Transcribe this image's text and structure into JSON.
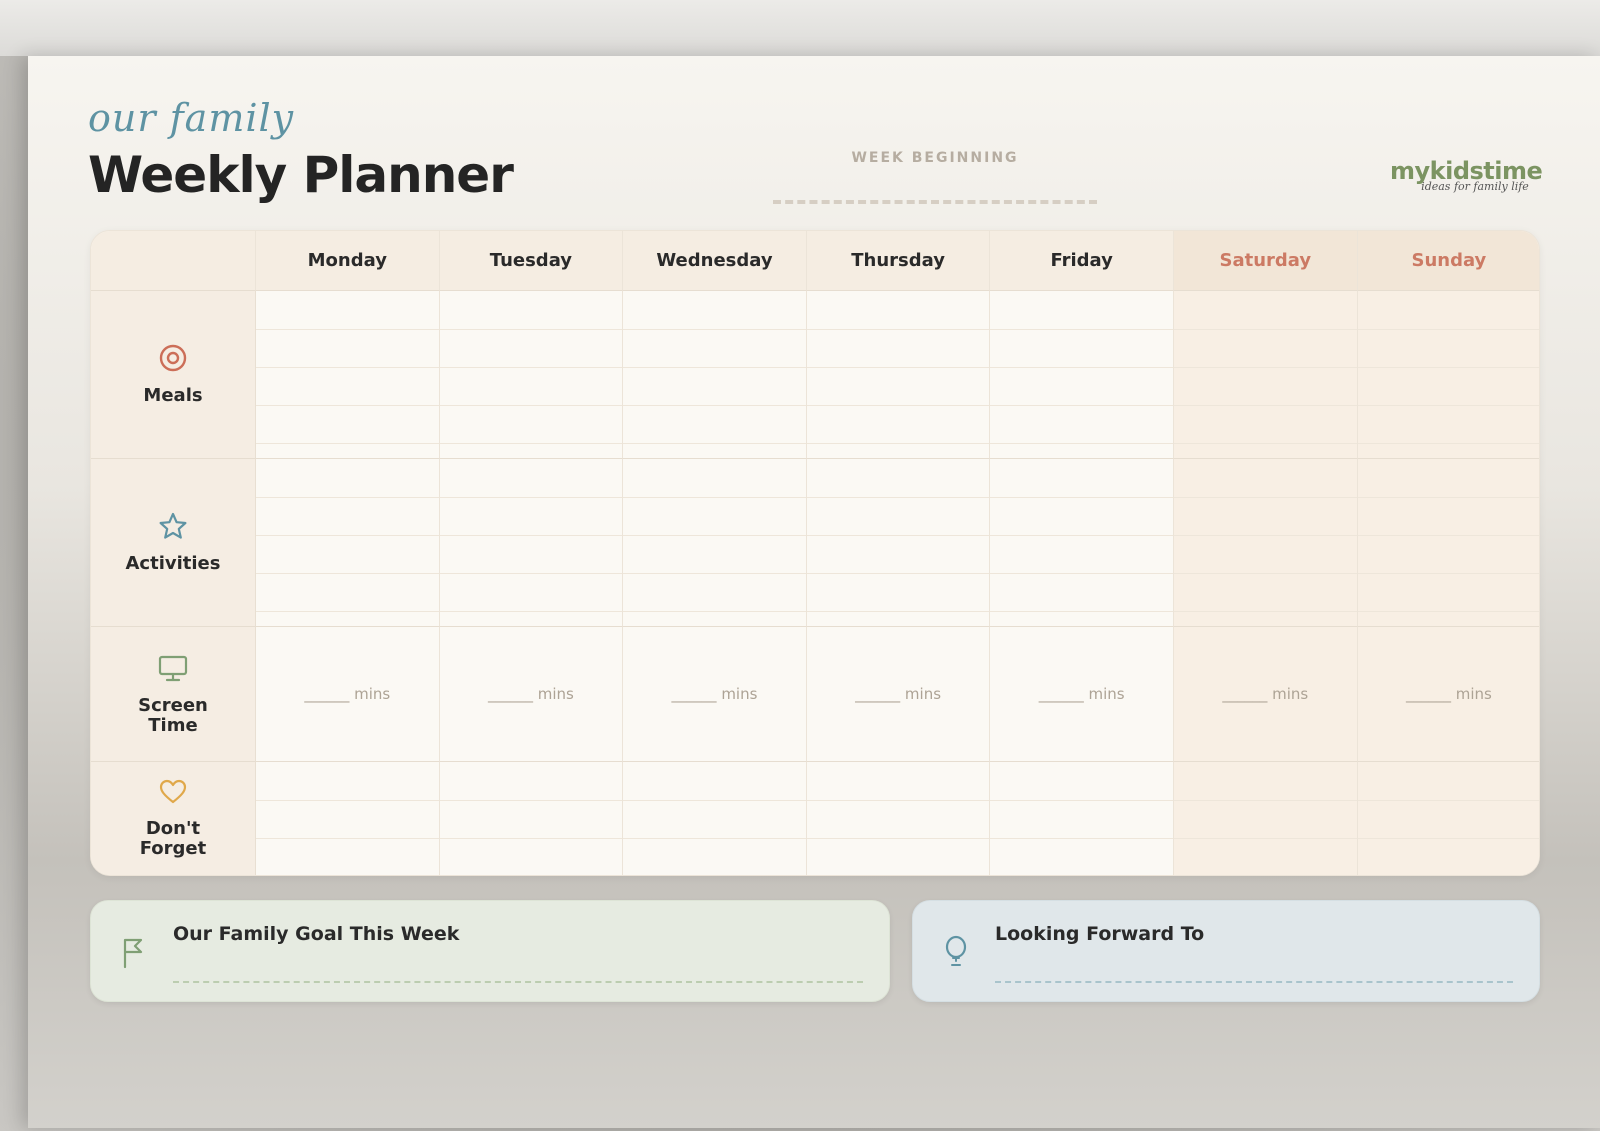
{
  "header": {
    "script_title": "our family",
    "title": "Weekly Planner",
    "week_label": "WEEK BEGINNING"
  },
  "brand": {
    "name": "mykidstime",
    "tagline": "ideas for family life"
  },
  "days": [
    {
      "label": "Monday",
      "weekend": false
    },
    {
      "label": "Tuesday",
      "weekend": false
    },
    {
      "label": "Wednesday",
      "weekend": false
    },
    {
      "label": "Thursday",
      "weekend": false
    },
    {
      "label": "Friday",
      "weekend": false
    },
    {
      "label": "Saturday",
      "weekend": true
    },
    {
      "label": "Sunday",
      "weekend": true
    }
  ],
  "rows": [
    {
      "label": "Meals",
      "icon": "target-icon",
      "icon_color": "#cc6e58",
      "lines": 4,
      "kind": "lines"
    },
    {
      "label": "Activities",
      "icon": "star-icon",
      "icon_color": "#5e93a3",
      "lines": 4,
      "kind": "lines"
    },
    {
      "label": "Screen\nTime",
      "icon": "monitor-icon",
      "icon_color": "#7f9f74",
      "lines": 0,
      "kind": "mins"
    },
    {
      "label": "Don't\nForget",
      "icon": "heart-icon",
      "icon_color": "#e0a84a",
      "lines": 3,
      "kind": "lines"
    }
  ],
  "screen_time_placeholder": "______ mins",
  "boxes": {
    "goal": {
      "title": "Our Family Goal This Week",
      "icon": "flag-icon"
    },
    "forward": {
      "title": "Looking Forward To",
      "icon": "balloon-icon"
    }
  },
  "colors": {
    "weekend_accent": "#cc7a64",
    "brand_green": "#7c9462",
    "script_blue": "#5e93a3"
  }
}
